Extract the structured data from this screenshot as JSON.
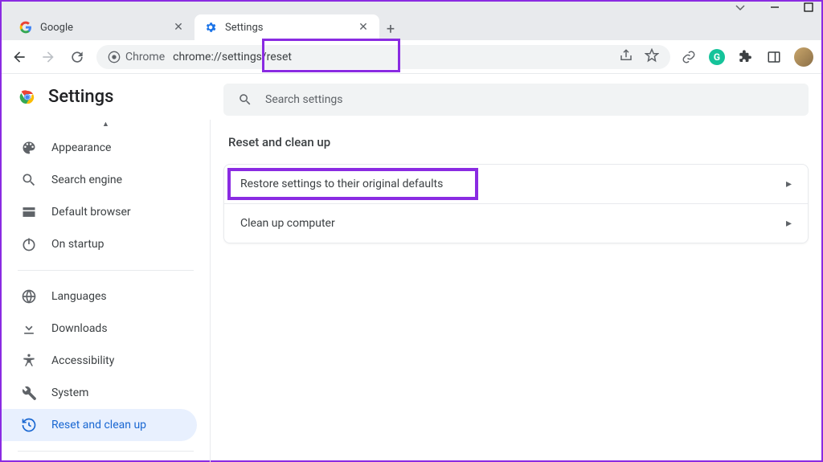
{
  "window": {
    "tabs": [
      {
        "title": "Google",
        "active": false
      },
      {
        "title": "Settings",
        "active": true
      }
    ]
  },
  "toolbar": {
    "site_label": "Chrome",
    "url": "chrome://settings/reset"
  },
  "settings": {
    "header": "Settings",
    "search_placeholder": "Search settings",
    "nav": {
      "appearance": "Appearance",
      "search_engine": "Search engine",
      "default_browser": "Default browser",
      "on_startup": "On startup",
      "languages": "Languages",
      "downloads": "Downloads",
      "accessibility": "Accessibility",
      "system": "System",
      "reset": "Reset and clean up"
    },
    "main": {
      "section_title": "Reset and clean up",
      "rows": {
        "restore": "Restore settings to their original defaults",
        "cleanup": "Clean up computer"
      }
    }
  }
}
